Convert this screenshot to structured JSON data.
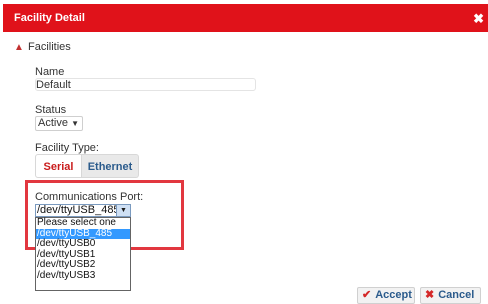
{
  "dialog": {
    "title": "Facility Detail",
    "close_icon": "close-icon"
  },
  "section": {
    "label": "Facilities"
  },
  "name": {
    "label": "Name",
    "value": "Default"
  },
  "status": {
    "label": "Status",
    "value": "Active"
  },
  "facility_type": {
    "label": "Facility Type:",
    "tabs": [
      "Serial",
      "Ethernet"
    ],
    "active_tab": "Serial"
  },
  "comm_port": {
    "label": "Communications Port:",
    "value": "/dev/ttyUSB_485",
    "options": [
      "Please select one",
      "/dev/ttyUSB_485",
      "/dev/ttyUSB0",
      "/dev/ttyUSB1",
      "/dev/ttyUSB2",
      "/dev/ttyUSB3"
    ],
    "highlighted": "/dev/ttyUSB_485"
  },
  "footer": {
    "accept": "Accept",
    "cancel": "Cancel"
  },
  "colors": {
    "titlebar": "#e0121a",
    "highlight_box": "#e2373f",
    "selection": "#3399ff"
  }
}
